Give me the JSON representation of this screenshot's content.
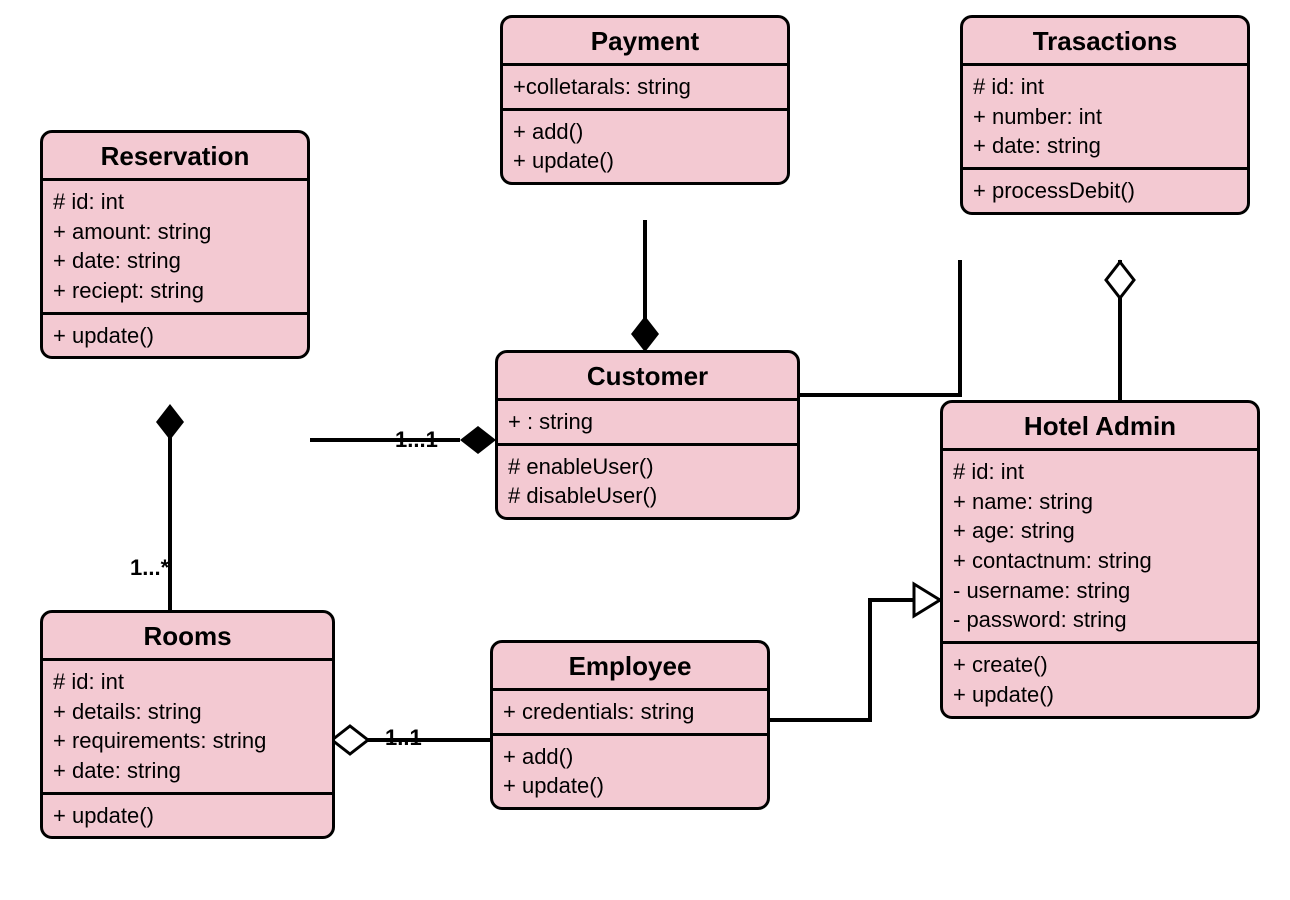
{
  "classes": {
    "reservation": {
      "name": "Reservation",
      "attributes": [
        "# id: int",
        "+ amount: string",
        "+ date: string",
        "+ reciept: string"
      ],
      "methods": [
        "+ update()"
      ]
    },
    "payment": {
      "name": "Payment",
      "attributes": [
        "+colletarals: string"
      ],
      "methods": [
        "+ add()",
        "+ update()"
      ]
    },
    "transactions": {
      "name": "Trasactions",
      "attributes": [
        "# id: int",
        "+ number: int",
        "+ date: string"
      ],
      "methods": [
        "+ processDebit()"
      ]
    },
    "customer": {
      "name": "Customer",
      "attributes": [
        "+ : string"
      ],
      "methods": [
        "# enableUser()",
        "# disableUser()"
      ]
    },
    "hoteladmin": {
      "name": "Hotel Admin",
      "attributes": [
        "# id: int",
        "+ name: string",
        "+ age: string",
        "+ contactnum: string",
        "- username: string",
        "- password: string"
      ],
      "methods": [
        "+ create()",
        "+ update()"
      ]
    },
    "rooms": {
      "name": "Rooms",
      "attributes": [
        "# id: int",
        "+ details: string",
        "+ requirements: string",
        "+ date: string"
      ],
      "methods": [
        "+ update()"
      ]
    },
    "employee": {
      "name": "Employee",
      "attributes": [
        "+ credentials: string"
      ],
      "methods": [
        "+ add()",
        "+ update()"
      ]
    }
  },
  "multiplicities": {
    "res_rooms_top": "1...*",
    "res_cust": "1...1",
    "rooms_emp": "1..1"
  },
  "relationships": [
    {
      "from": "Customer",
      "to": "Payment",
      "type": "composition_filled_diamond_at_customer"
    },
    {
      "from": "Customer",
      "to": "Reservation",
      "type": "composition_filled_diamond_at_customer",
      "mult": "1...1"
    },
    {
      "from": "Reservation",
      "to": "Rooms",
      "type": "composition_filled_diamond_at_reservation",
      "mult": "1...*"
    },
    {
      "from": "Rooms",
      "to": "Employee",
      "type": "aggregation_hollow_diamond_at_rooms",
      "mult": "1..1"
    },
    {
      "from": "Customer",
      "to": "Transactions",
      "type": "association"
    },
    {
      "from": "HotelAdmin",
      "to": "Transactions",
      "type": "aggregation_hollow_diamond_at_hoteladmin_side"
    },
    {
      "from": "Employee",
      "to": "HotelAdmin",
      "type": "generalization_hollow_triangle_toward_hoteladmin"
    }
  ]
}
